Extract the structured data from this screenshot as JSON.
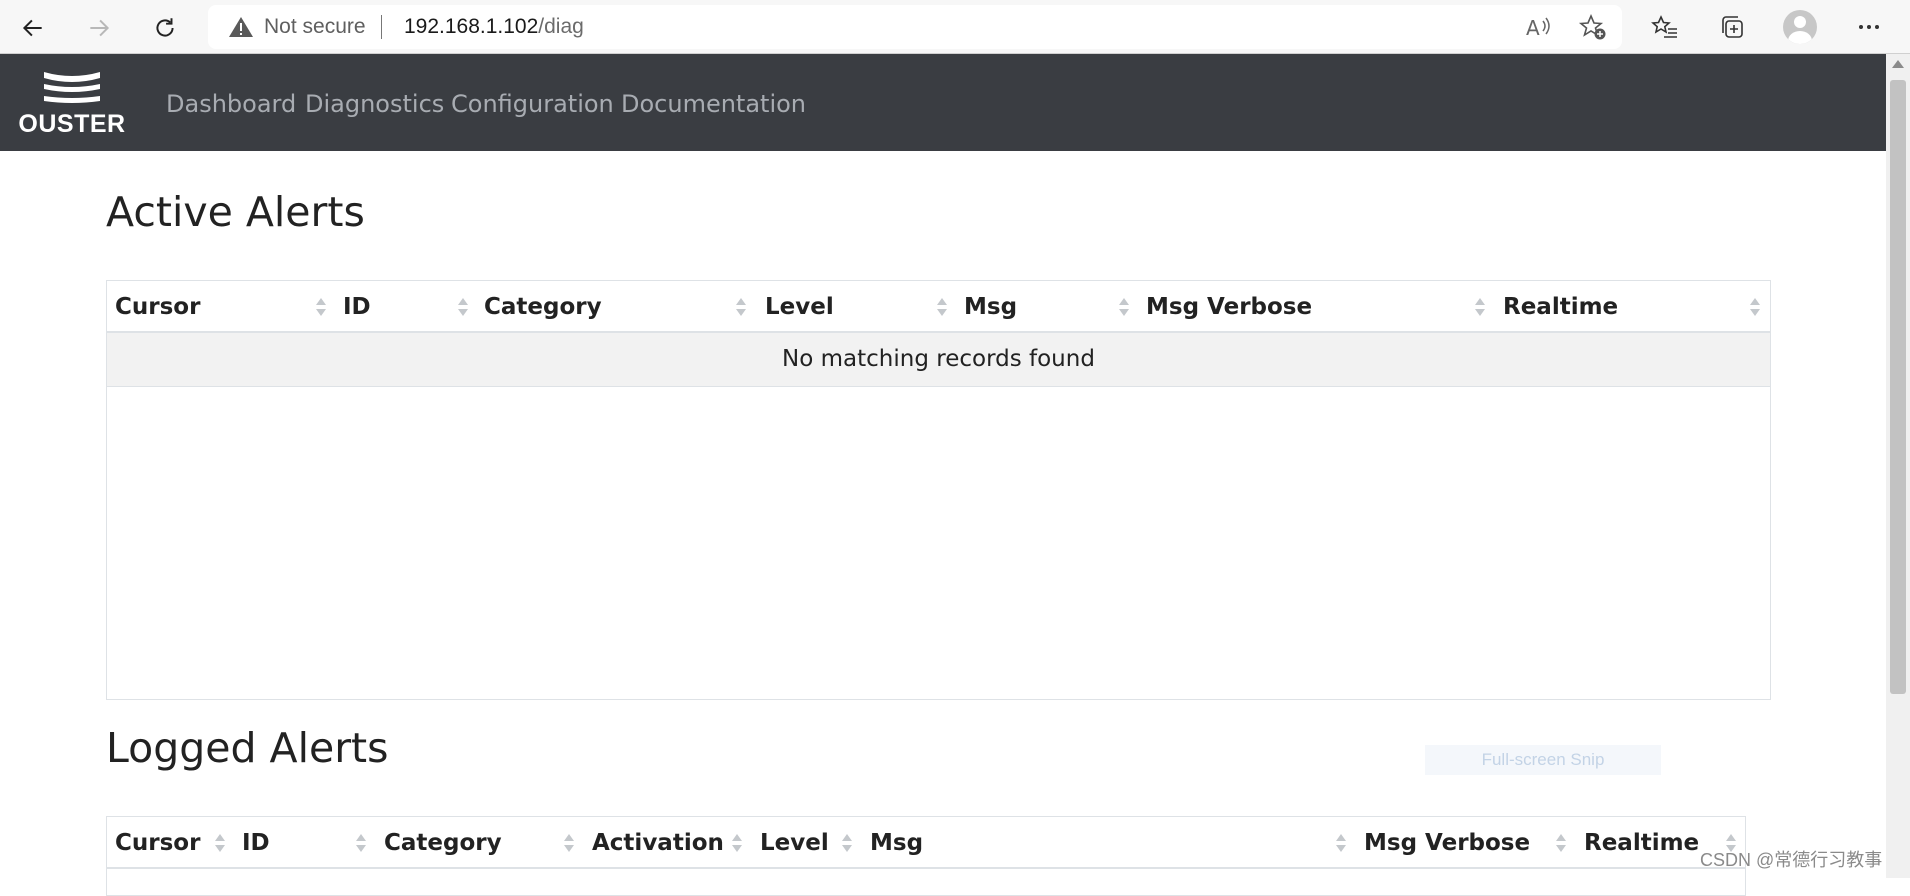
{
  "browser": {
    "security_label": "Not secure",
    "url_host": "192.168.1.102",
    "url_path": "/diag"
  },
  "navbar": {
    "logo_text": "OUSTER",
    "links": [
      "Dashboard",
      "Diagnostics",
      "Configuration",
      "Documentation"
    ]
  },
  "active_alerts": {
    "title": "Active Alerts",
    "columns": [
      "Cursor",
      "ID",
      "Category",
      "Level",
      "Msg",
      "Msg Verbose",
      "Realtime"
    ],
    "empty_message": "No matching records found"
  },
  "logged_alerts": {
    "title": "Logged Alerts",
    "columns": [
      "Cursor",
      "ID",
      "Category",
      "Activation",
      "Level",
      "Msg",
      "Msg Verbose",
      "Realtime"
    ]
  },
  "overlay": {
    "snip_label": "Full-screen Snip",
    "watermark": "CSDN @常德行习教事"
  }
}
